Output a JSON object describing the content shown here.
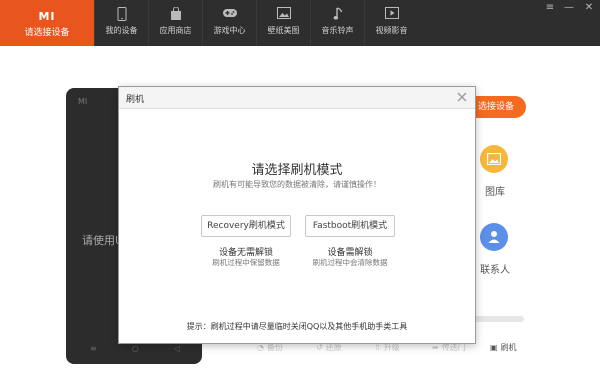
{
  "header": {
    "brand_logo": "MI",
    "brand_label": "请选接设备",
    "nav": [
      {
        "label": "我的设备",
        "icon": "phone-icon"
      },
      {
        "label": "应用商店",
        "icon": "bag-icon"
      },
      {
        "label": "游戏中心",
        "icon": "gamepad-icon"
      },
      {
        "label": "壁纸美图",
        "icon": "image-icon"
      },
      {
        "label": "音乐铃声",
        "icon": "music-note-icon"
      },
      {
        "label": "视频影音",
        "icon": "video-play-icon"
      }
    ],
    "window_controls": {
      "menu": "≡",
      "minimize": "—",
      "close": "✕"
    }
  },
  "device_panel": {
    "logo": "MI",
    "prompt_partial": "请使用U",
    "nav_glyphs": [
      "≡",
      "○",
      "◁"
    ],
    "connect_button": "选接设备"
  },
  "side_actions": [
    {
      "label": "图库",
      "icon": "gallery-icon",
      "color": "#f5b83a"
    },
    {
      "label": "联系人",
      "icon": "contact-icon",
      "color": "#5b8fe8"
    }
  ],
  "bottom_bar": [
    {
      "label": "备份",
      "icon": "backup-icon",
      "enabled": false
    },
    {
      "label": "还原",
      "icon": "restore-icon",
      "enabled": false
    },
    {
      "label": "升级",
      "icon": "upgrade-icon",
      "enabled": false
    },
    {
      "label": "传送门",
      "icon": "portal-icon",
      "enabled": false
    },
    {
      "label": "刷机",
      "icon": "flash-icon",
      "enabled": true
    }
  ],
  "modal": {
    "title": "刷机",
    "heading": "请选择刷机模式",
    "subtitle": "刷机有可能导致您的数据被清除，请谨慎操作！",
    "modes": [
      {
        "button": "Recovery刷机模式",
        "title": "设备无需解锁",
        "desc": "刷机过程中保留数据"
      },
      {
        "button": "Fastboot刷机模式",
        "title": "设备需解锁",
        "desc": "刷机过程中会清除数据"
      }
    ],
    "tip": "提示：刷机过程中请尽量临时关闭QQ以及其他手机助手类工具"
  },
  "colors": {
    "brand": "#e8561d",
    "topbar": "#2e2e2e",
    "accent": "#f56a1e"
  }
}
